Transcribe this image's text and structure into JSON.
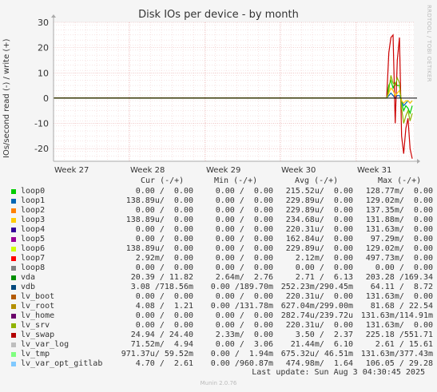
{
  "chart_data": {
    "type": "line",
    "title": "Disk IOs per device - by month",
    "ylabel": "IOs/second read (-) / write (+)",
    "ylim": [
      -25,
      30
    ],
    "yticks": [
      30,
      20,
      10,
      0,
      -10,
      -20
    ],
    "xticks": [
      "Week 27",
      "Week 28",
      "Week 29",
      "Week 30",
      "Week 31"
    ],
    "series": [
      {
        "name": "vda",
        "color": "#00cc00",
        "values": [
          0,
          0,
          0,
          0,
          0,
          5,
          7,
          4,
          6,
          5,
          5,
          -2,
          -5,
          -3,
          -4,
          -6,
          -3
        ]
      },
      {
        "name": "vdb",
        "color": "#0066b3",
        "values": [
          0,
          0,
          0,
          0,
          0,
          1,
          2,
          1,
          0,
          1,
          1,
          -1,
          -3,
          -2,
          -1,
          -2,
          -1
        ]
      },
      {
        "name": "lv_swap",
        "color": "#cc0000",
        "values": [
          0,
          0,
          0,
          0,
          0,
          18,
          24,
          25,
          -10,
          15,
          24,
          -15,
          -22,
          -12,
          -8,
          -20,
          -24
        ]
      },
      {
        "name": "lv_root",
        "color": "#ffcc00",
        "values": [
          0,
          0,
          0,
          0,
          0,
          2,
          4,
          3,
          1,
          2,
          3,
          -1,
          -2,
          -1,
          -1,
          -2,
          -1
        ]
      },
      {
        "name": "lv_tmp",
        "color": "#8fb300",
        "values": [
          0,
          0,
          0,
          0,
          0,
          3,
          9,
          6,
          5,
          8,
          6,
          -4,
          -10,
          -7,
          -5,
          -9,
          -6
        ]
      }
    ]
  },
  "rrdtool_label": "RRDTOOL / TOBI OETIKER",
  "legend_header": {
    "cur": "Cur (-/+)",
    "min": "Min (-/+)",
    "avg": "Avg (-/+)",
    "max": "Max (-/+)"
  },
  "legend": [
    {
      "name": "loop0",
      "color": "#00cc00",
      "cur": "0.00 /  0.00",
      "min": "0.00 /  0.00",
      "avg": "215.52u/  0.00",
      "max": "128.77m/  0.00"
    },
    {
      "name": "loop1",
      "color": "#0066b3",
      "cur": "138.89u/  0.00",
      "min": "0.00 /  0.00",
      "avg": "229.89u/  0.00",
      "max": "129.02m/  0.00"
    },
    {
      "name": "loop2",
      "color": "#ff8000",
      "cur": "0.00 /  0.00",
      "min": "0.00 /  0.00",
      "avg": "229.89u/  0.00",
      "max": "137.35m/  0.00"
    },
    {
      "name": "loop3",
      "color": "#ffcc00",
      "cur": "138.89u/  0.00",
      "min": "0.00 /  0.00",
      "avg": "234.68u/  0.00",
      "max": "131.88m/  0.00"
    },
    {
      "name": "loop4",
      "color": "#330099",
      "cur": "0.00 /  0.00",
      "min": "0.00 /  0.00",
      "avg": "220.31u/  0.00",
      "max": "131.63m/  0.00"
    },
    {
      "name": "loop5",
      "color": "#990099",
      "cur": "0.00 /  0.00",
      "min": "0.00 /  0.00",
      "avg": "162.84u/  0.00",
      "max": "97.29m/  0.00"
    },
    {
      "name": "loop6",
      "color": "#ccff00",
      "cur": "138.89u/  0.00",
      "min": "0.00 /  0.00",
      "avg": "229.89u/  0.00",
      "max": "129.02m/  0.00"
    },
    {
      "name": "loop7",
      "color": "#ff0000",
      "cur": "2.92m/  0.00",
      "min": "0.00 /  0.00",
      "avg": "2.12m/  0.00",
      "max": "497.73m/  0.00"
    },
    {
      "name": "loop8",
      "color": "#808080",
      "cur": "0.00 /  0.00",
      "min": "0.00 /  0.00",
      "avg": "0.00 /  0.00",
      "max": "0.00 /  0.00"
    },
    {
      "name": "vda",
      "color": "#008f00",
      "cur": "20.39 / 11.82",
      "min": "2.64m/  2.76",
      "avg": "2.71 /  6.13",
      "max": "203.28 /169.34"
    },
    {
      "name": "vdb",
      "color": "#00487d",
      "cur": "3.08 /718.56m",
      "min": "0.00 /189.70m",
      "avg": "252.23m/290.45m",
      "max": "64.11 /  8.72"
    },
    {
      "name": "lv_boot",
      "color": "#b35a00",
      "cur": "0.00 /  0.00",
      "min": "0.00 /  0.00",
      "avg": "220.31u/  0.00",
      "max": "131.63m/  0.00"
    },
    {
      "name": "lv_root",
      "color": "#b38f00",
      "cur": "4.08 /  1.21",
      "min": "0.00 /131.78m",
      "avg": "627.04m/299.00m",
      "max": "81.68 / 22.54"
    },
    {
      "name": "lv_home",
      "color": "#6b006b",
      "cur": "0.00 /  0.00",
      "min": "0.00 /  0.00",
      "avg": "282.74u/239.72u",
      "max": "131.63m/114.91m"
    },
    {
      "name": "lv_srv",
      "color": "#8fb300",
      "cur": "0.00 /  0.00",
      "min": "0.00 /  0.00",
      "avg": "220.31u/  0.00",
      "max": "131.63m/  0.00"
    },
    {
      "name": "lv_swap",
      "color": "#b30000",
      "cur": "24.94 / 24.40",
      "min": "2.33m/  0.00",
      "avg": "3.50 /  2.37",
      "max": "225.18 /551.71"
    },
    {
      "name": "lv_var_log",
      "color": "#bebebe",
      "cur": "71.52m/  4.94",
      "min": "0.00 /  3.06",
      "avg": "21.44m/  6.10",
      "max": "2.61 / 15.61"
    },
    {
      "name": "lv_tmp",
      "color": "#80ff80",
      "cur": "971.37u/ 59.52m",
      "min": "0.00 /  1.94m",
      "avg": "675.32u/ 46.51m",
      "max": "131.63m/377.43m"
    },
    {
      "name": "lv_var_opt_gitlab",
      "color": "#80c9ff",
      "cur": "4.70 /  2.61",
      "min": "0.00 /960.87m",
      "avg": "474.98m/  1.64",
      "max": "106.05 / 29.28"
    }
  ],
  "last_update": "Last update: Sun Aug  3 04:30:45 2025",
  "footer": "Munin 2.0.76"
}
